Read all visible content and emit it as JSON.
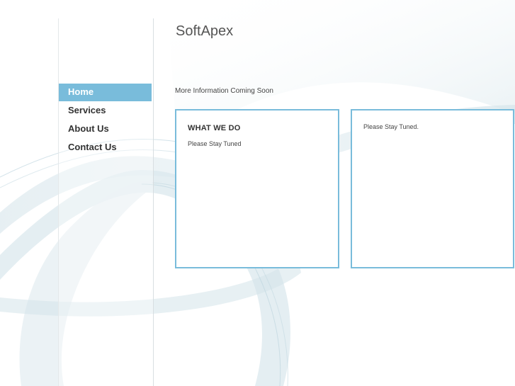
{
  "site": {
    "title": "SoftApex",
    "tagline": "More Information Coming Soon"
  },
  "nav": {
    "items": [
      {
        "label": "Home",
        "active": true
      },
      {
        "label": "Services",
        "active": false
      },
      {
        "label": "About Us",
        "active": false
      },
      {
        "label": "Contact Us",
        "active": false
      }
    ]
  },
  "boxes": {
    "left": {
      "heading": "WHAT WE DO",
      "text": "Please Stay Tuned"
    },
    "right": {
      "text": "Please Stay Tuned."
    }
  },
  "colors": {
    "accent": "#79bcdb",
    "wave": "#cfe1e8"
  }
}
